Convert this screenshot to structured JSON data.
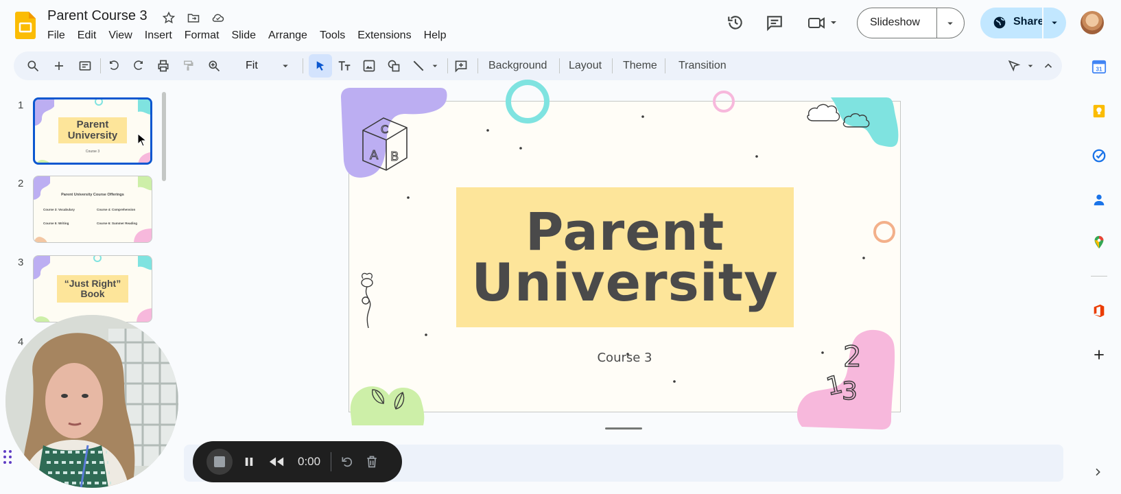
{
  "doc": {
    "title": "Parent Course 3"
  },
  "menu": [
    "File",
    "Edit",
    "View",
    "Insert",
    "Format",
    "Slide",
    "Arrange",
    "Tools",
    "Extensions",
    "Help"
  ],
  "header": {
    "slideshow_label": "Slideshow",
    "share_label": "Share"
  },
  "toolbar": {
    "zoom": "Fit",
    "background": "Background",
    "layout": "Layout",
    "theme": "Theme",
    "transition": "Transition"
  },
  "filmstrip": {
    "slides": [
      {
        "number": "1",
        "title": "Parent University",
        "subtitle": "Course 3"
      },
      {
        "number": "2",
        "title": "Parent University Course Offerings",
        "items": [
          "Course 3: Vocabulary",
          "Course 4: Comprehension",
          "Course 5: Writing",
          "Course 6: Summer Reading"
        ]
      },
      {
        "number": "3",
        "title": "“Just Right” Book"
      },
      {
        "number": "4"
      }
    ]
  },
  "slide": {
    "title_line1": "Parent",
    "title_line2": "University",
    "subtitle": "Course 3"
  },
  "recorder": {
    "time": "0:00"
  },
  "colors": {
    "accent_blue": "#0b57d0",
    "share_bg": "#c2e7ff",
    "title_box": "#fde59a",
    "purple_blob": "#bcaef2",
    "teal_blob": "#7fe3e0",
    "pink_blob": "#f7b8dc",
    "green_blob": "#cdefa8"
  }
}
